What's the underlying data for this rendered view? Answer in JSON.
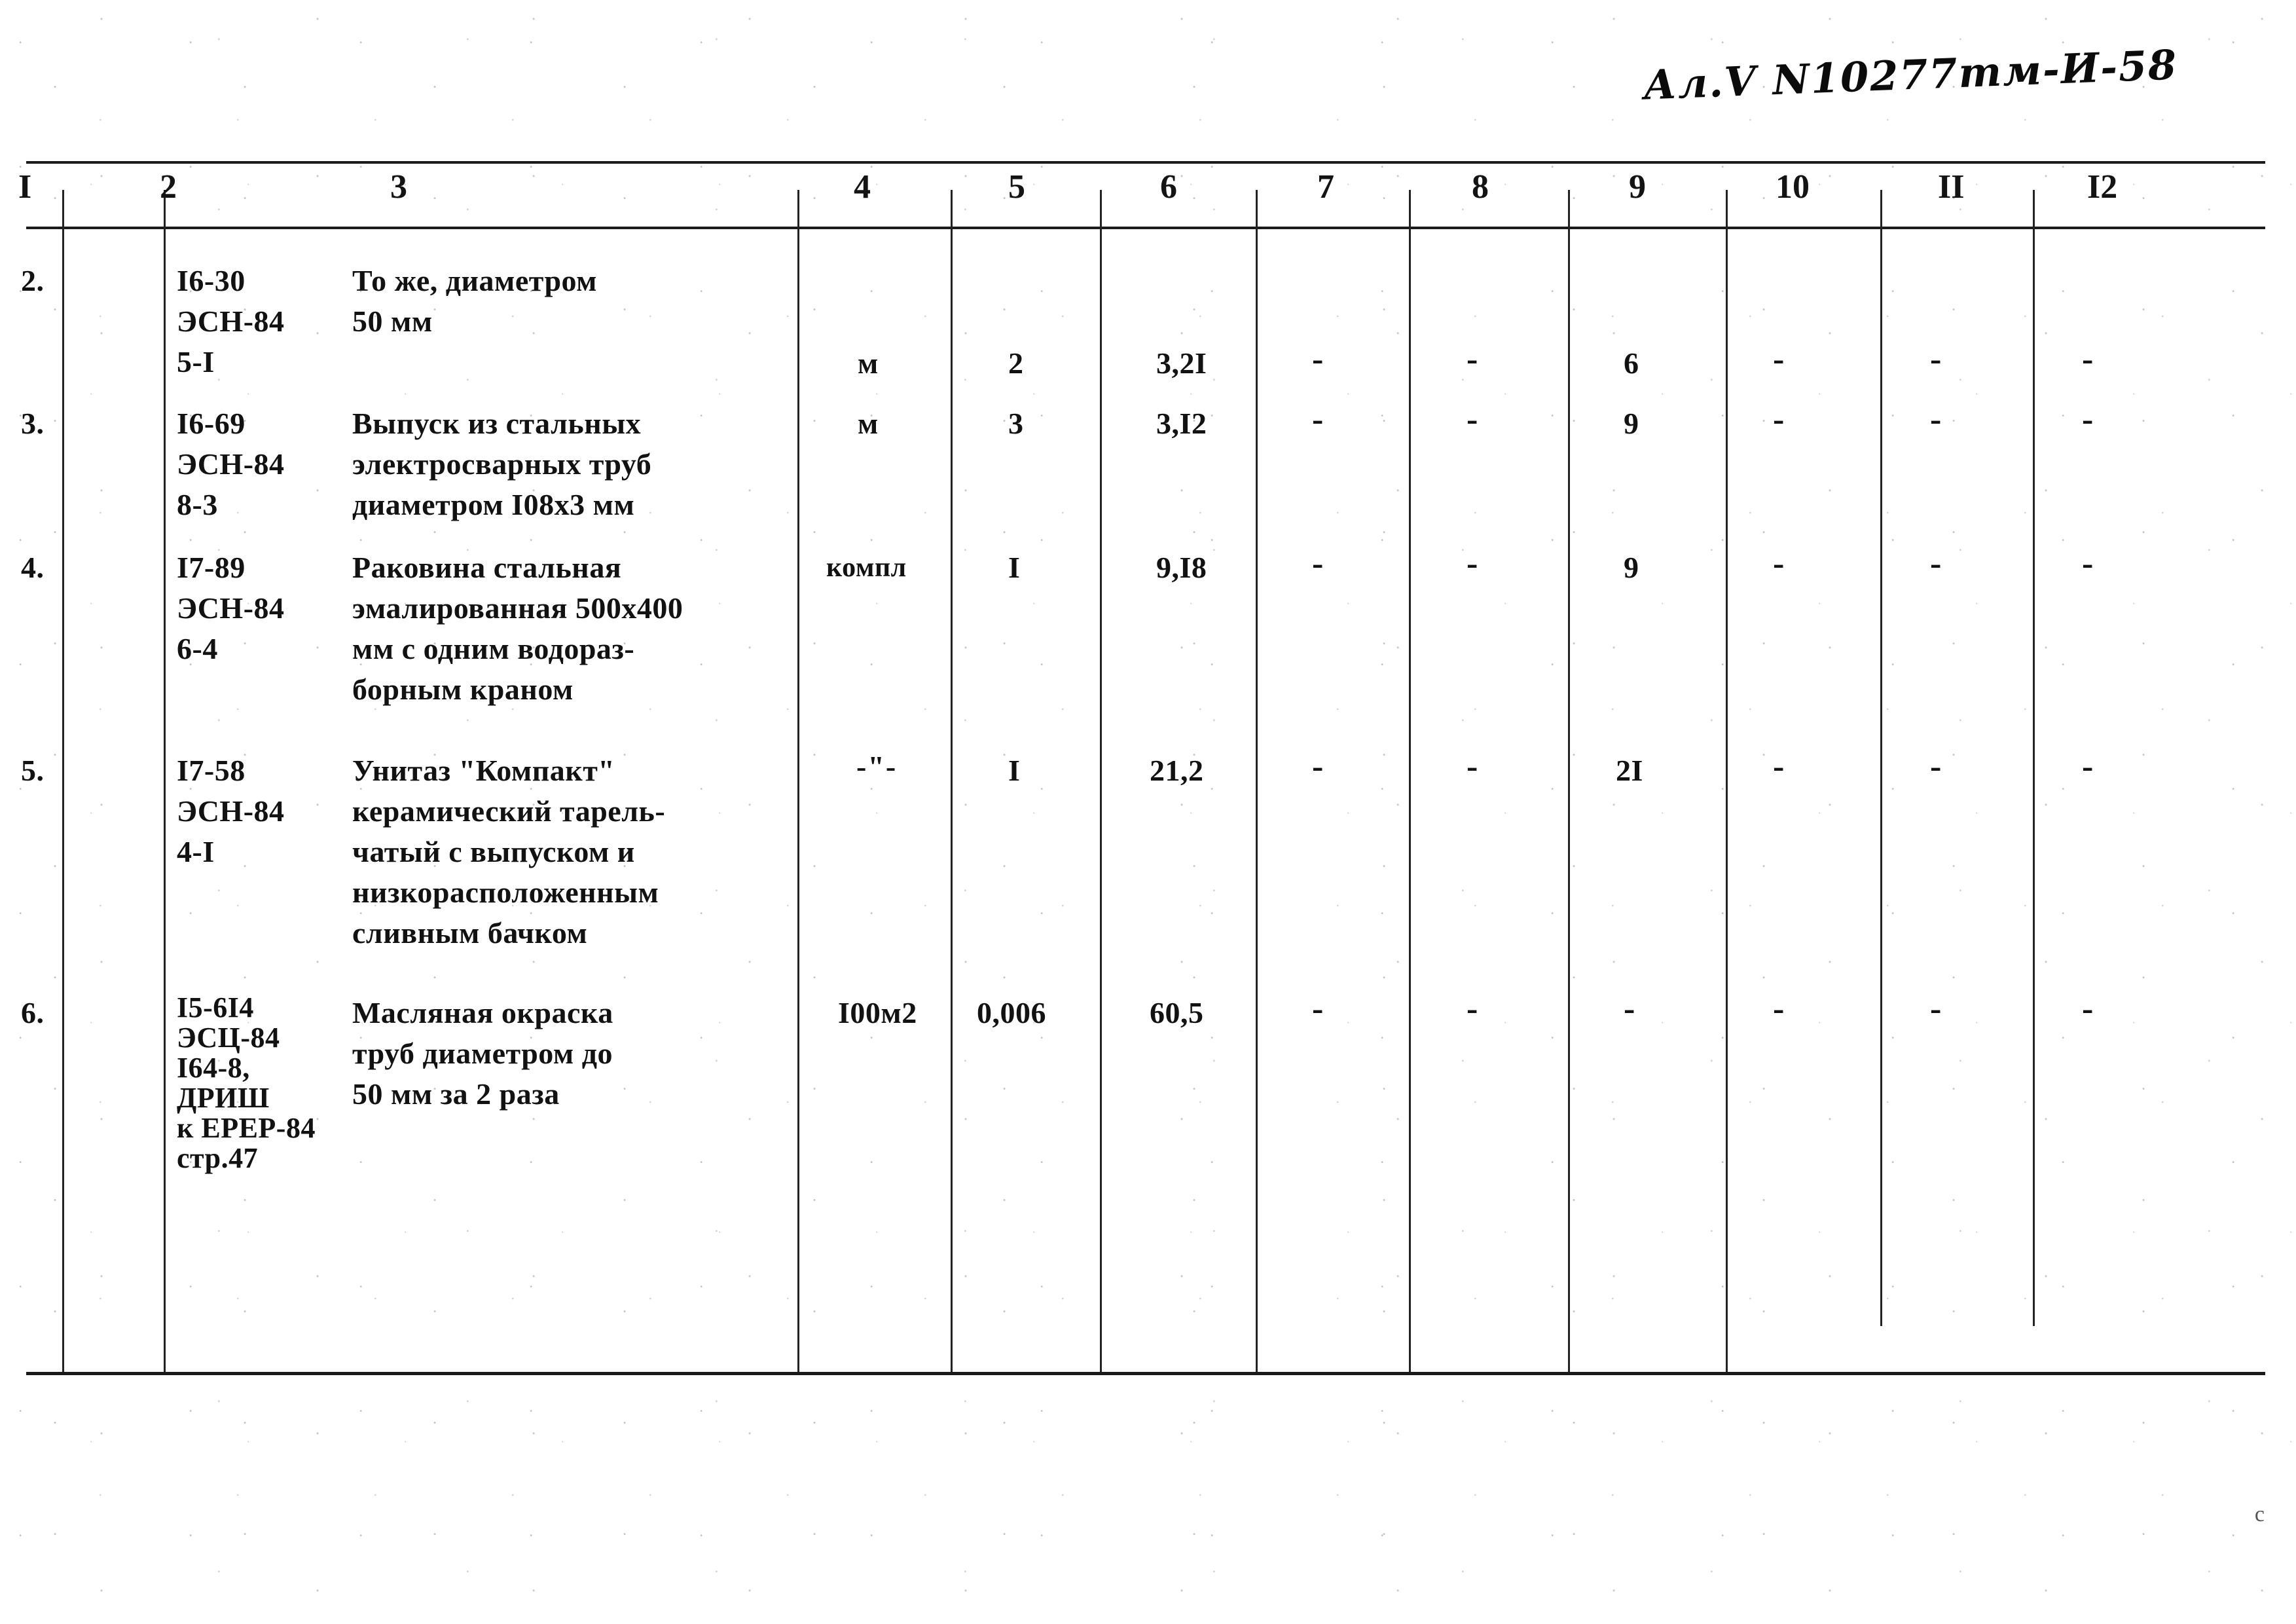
{
  "page": {
    "handwritten_annotation": "Ал.Ⅴ N10277тм-И-58",
    "corner_mark": "c"
  },
  "table": {
    "column_headers": [
      "I",
      "2",
      "3",
      "4",
      "5",
      "6",
      "7",
      "8",
      "9",
      "10",
      "II",
      "I2"
    ],
    "rows": [
      {
        "no": "2.",
        "code_lines": [
          "I6-30",
          "ЭСН-84",
          "5-I"
        ],
        "description_lines": [
          "То же, диаметром",
          "50 мм"
        ],
        "unit": "м",
        "qty": "2",
        "price": "3,2I",
        "c7": "-",
        "c8": "-",
        "c9": "6",
        "c10": "-",
        "c11": "-",
        "c12": "-"
      },
      {
        "no": "3.",
        "code_lines": [
          "I6-69",
          "ЭСН-84",
          "8-3"
        ],
        "description_lines": [
          "Выпуск из стальных",
          "электросварных труб",
          "диаметром I08х3 мм"
        ],
        "unit": "м",
        "qty": "3",
        "price": "3,I2",
        "c7": "-",
        "c8": "-",
        "c9": "9",
        "c10": "-",
        "c11": "-",
        "c12": "-"
      },
      {
        "no": "4.",
        "code_lines": [
          "I7-89",
          "ЭСН-84",
          "6-4"
        ],
        "description_lines": [
          "Раковина стальная",
          "эмалированная 500х400",
          "мм с одним водораз-",
          "борным краном"
        ],
        "unit": "компл",
        "qty": "I",
        "price": "9,I8",
        "c7": "-",
        "c8": "-",
        "c9": "9",
        "c10": "-",
        "c11": "-",
        "c12": "-"
      },
      {
        "no": "5.",
        "code_lines": [
          "I7-58",
          "ЭСН-84",
          "4-I"
        ],
        "description_lines": [
          "Унитаз \"Компакт\"",
          "керамический тарель-",
          "чатый с выпуском и",
          "низкорасположенным",
          "сливным бачком"
        ],
        "unit": "-\"-",
        "qty": "I",
        "price": "21,2",
        "c7": "-",
        "c8": "-",
        "c9": "2I",
        "c10": "-",
        "c11": "-",
        "c12": "-"
      },
      {
        "no": "6.",
        "code_lines": [
          "I5-6I4",
          "ЭСЦ-84",
          "I64-8,",
          "ДРИШ",
          "к ЕРЕР-84",
          "стр.47"
        ],
        "description_lines": [
          "Масляная окраска",
          "труб диаметром до",
          "50 мм за 2 раза"
        ],
        "unit": "I00м2",
        "qty": "0,006",
        "price": "60,5",
        "c7": "-",
        "c8": "-",
        "c9": "-",
        "c10": "-",
        "c11": "-",
        "c12": "-"
      }
    ]
  }
}
